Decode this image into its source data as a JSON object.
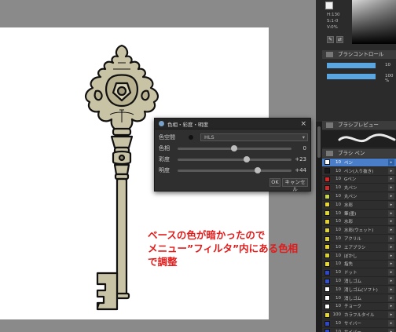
{
  "annotation": {
    "lines": [
      "ベースの色が暗かったので",
      "メニュー”フィルタ”内にある色相",
      "で調整"
    ]
  },
  "hsl_dialog": {
    "title": "色相・彩度・明度",
    "close_glyph": "×",
    "colorspace_label": "色空間",
    "colorspace_value": "HLS",
    "hue_label": "色相",
    "hue_value": "0",
    "saturation_label": "彩度",
    "saturation_value": "+23",
    "lightness_label": "明度",
    "lightness_value": "+44",
    "ok_label": "OK",
    "cancel_label": "キャンセル"
  },
  "color_panel": {
    "h_value": "H:130",
    "s_value": "S:1-0",
    "v_value": "V:0%"
  },
  "panels": {
    "brush_control_title": "ブラシコントロール",
    "stroke_preview_title": "ブラシプレビュー",
    "brush_list_title": "ブラシ ペン"
  },
  "brush_control": {
    "size_value": "10",
    "opacity_value": "100 %"
  },
  "brush_list": [
    {
      "size": "10",
      "name": "ペン",
      "color": "#ffffff",
      "selected": true
    },
    {
      "size": "10",
      "name": "ペン(入り抜き)",
      "color": "#1b1b1b",
      "selected": false
    },
    {
      "size": "10",
      "name": "Gペン",
      "color": "#d32626",
      "selected": false
    },
    {
      "size": "10",
      "name": "丸ペン",
      "color": "#cc2b2b",
      "selected": false
    },
    {
      "size": "10",
      "name": "丸ペン",
      "color": "#c7d34a",
      "selected": false
    },
    {
      "size": "10",
      "name": "水彩",
      "color": "#e6d431",
      "selected": false
    },
    {
      "size": "10",
      "name": "筆(墨)",
      "color": "#dcd52d",
      "selected": false
    },
    {
      "size": "10",
      "name": "水彩",
      "color": "#e2cf2b",
      "selected": false
    },
    {
      "size": "10",
      "name": "水彩(ウェット)",
      "color": "#dfd23a",
      "selected": false
    },
    {
      "size": "10",
      "name": "アクリル",
      "color": "#d9cc36",
      "selected": false
    },
    {
      "size": "10",
      "name": "エアブラシ",
      "color": "#e4d12e",
      "selected": false
    },
    {
      "size": "10",
      "name": "ぼかし",
      "color": "#d8d22f",
      "selected": false
    },
    {
      "size": "10",
      "name": "指先",
      "color": "#e7d730",
      "selected": false
    },
    {
      "size": "10",
      "name": "ドット",
      "color": "#2d49c9",
      "selected": false
    },
    {
      "size": "10",
      "name": "消しゴム",
      "color": "#3451cd",
      "selected": false
    },
    {
      "size": "10",
      "name": "消しゴム(ソフト)",
      "color": "#ffffff",
      "selected": false
    },
    {
      "size": "10",
      "name": "消しゴム",
      "color": "#ffffff",
      "selected": false
    },
    {
      "size": "10",
      "name": "チョーク",
      "color": "#ffffff",
      "selected": false
    },
    {
      "size": "100",
      "name": "カラフルタイル",
      "color": "#e5d636",
      "selected": false
    },
    {
      "size": "10",
      "name": "サイバー",
      "color": "#2f48c7",
      "selected": false
    },
    {
      "size": "10",
      "name": "サイバー",
      "color": "#304bca",
      "selected": false
    },
    {
      "size": "10",
      "name": "ふわふわパステル",
      "color": "#3048c8",
      "selected": false
    }
  ]
}
